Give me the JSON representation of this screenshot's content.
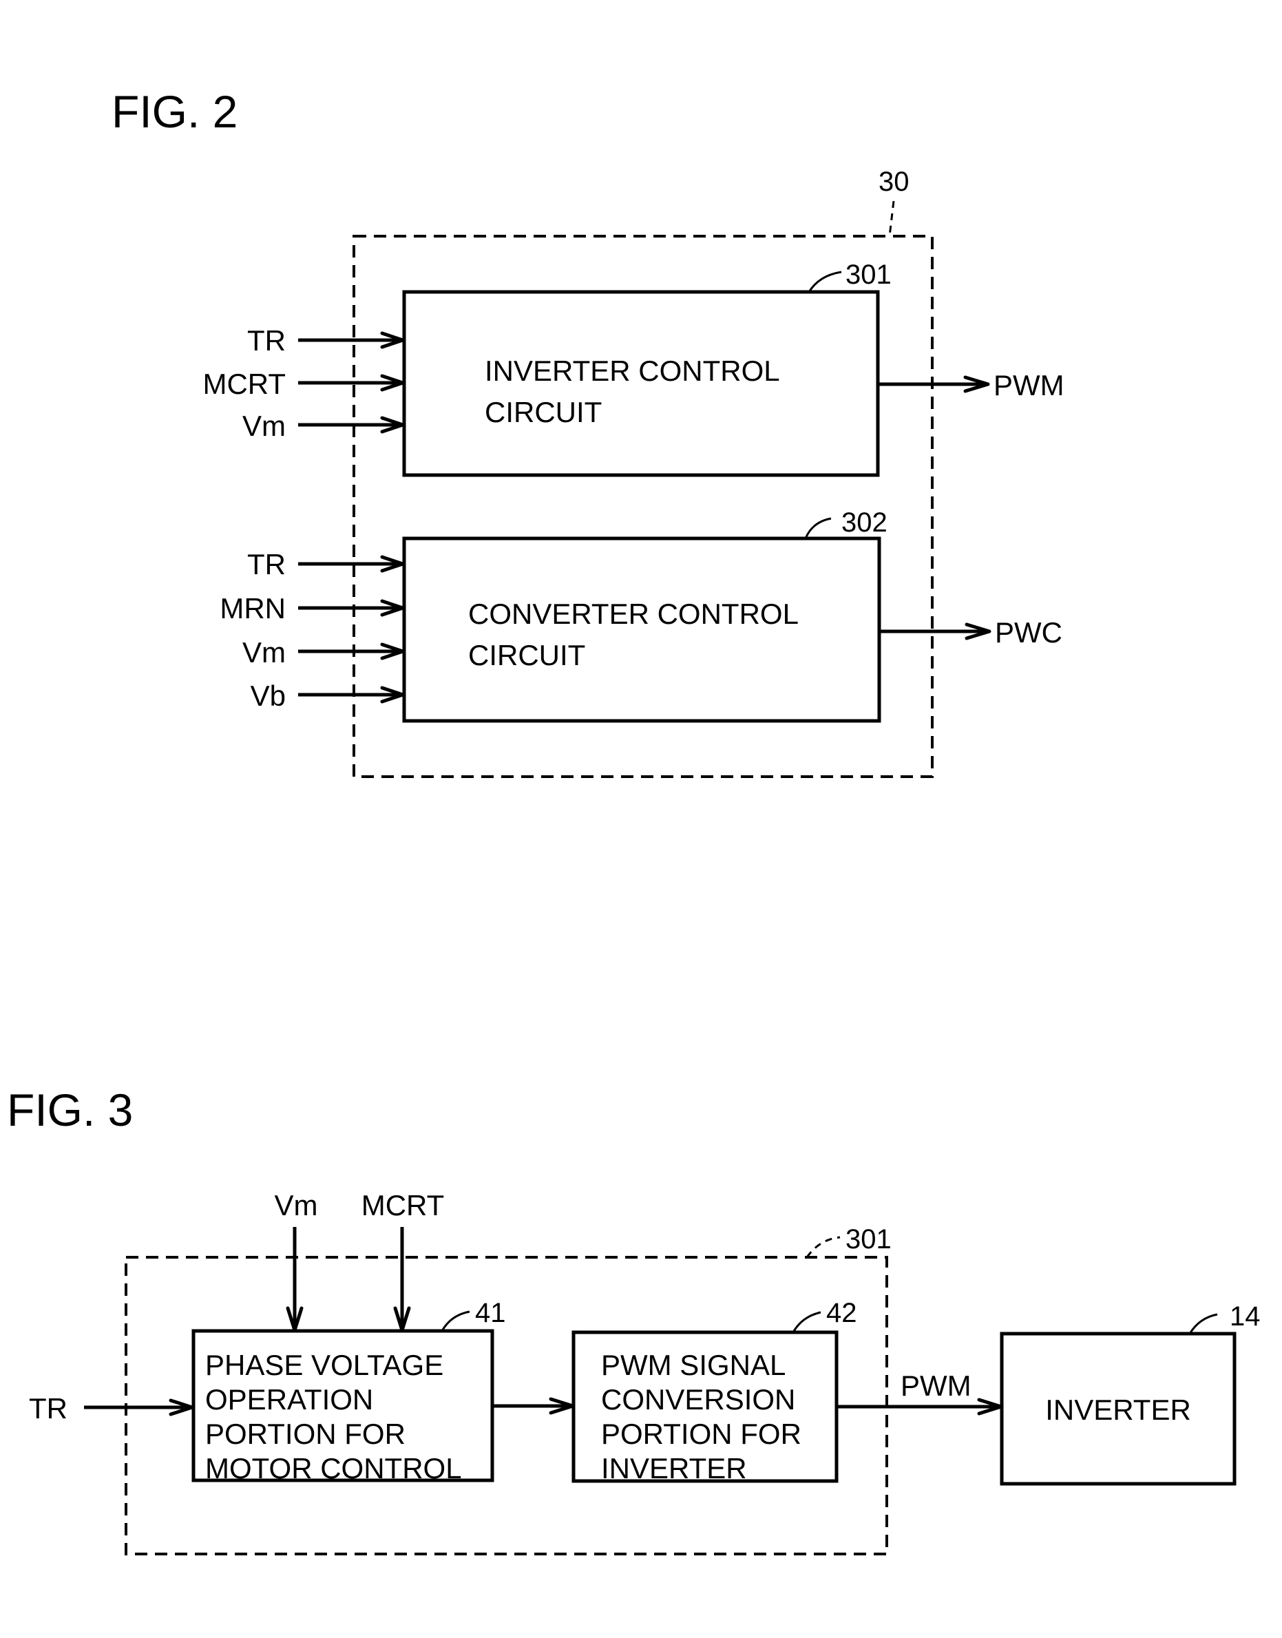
{
  "fig2": {
    "title": "FIG. 2",
    "container_ref": "30",
    "blocks": [
      {
        "ref": "301",
        "lines": [
          "INVERTER CONTROL",
          "CIRCUIT"
        ],
        "inputs": [
          "TR",
          "MCRT",
          "Vm"
        ],
        "output": "PWM"
      },
      {
        "ref": "302",
        "lines": [
          "CONVERTER CONTROL",
          "CIRCUIT"
        ],
        "inputs": [
          "TR",
          "MRN",
          "Vm",
          "Vb"
        ],
        "output": "PWC"
      }
    ]
  },
  "fig3": {
    "title": "FIG. 3",
    "container_ref": "301",
    "left_input": "TR",
    "top_inputs": [
      "Vm",
      "MCRT"
    ],
    "blocks": [
      {
        "ref": "41",
        "lines": [
          "PHASE VOLTAGE",
          "OPERATION",
          "PORTION FOR",
          "MOTOR CONTROL"
        ]
      },
      {
        "ref": "42",
        "lines": [
          "PWM SIGNAL",
          "CONVERSION",
          "PORTION FOR",
          "INVERTER"
        ]
      },
      {
        "ref": "14",
        "lines": [
          "INVERTER"
        ]
      }
    ],
    "link_label": "PWM"
  }
}
